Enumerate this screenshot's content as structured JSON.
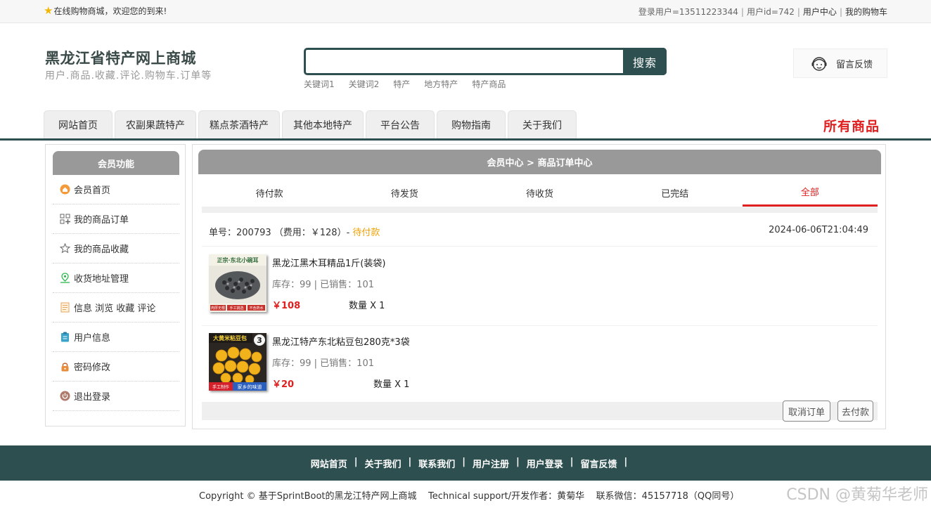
{
  "topbar": {
    "welcome": "在线购物商城，欢迎您的到来!",
    "login_user": "登录用户=13511223344",
    "user_id": "用户id=742",
    "user_center": "用户中心",
    "my_cart": "我的购物车"
  },
  "header": {
    "title": "黑龙江省特产网上商城",
    "subtitle": "用户.商品.收藏.评论.购物车.订单等",
    "search": {
      "value": "",
      "button": "搜索"
    },
    "hot_keywords": [
      "关键词1",
      "关键词2",
      "特产",
      "地方特产",
      "特产商品"
    ],
    "feedback": "留言反馈"
  },
  "nav": {
    "tabs": [
      "网站首页",
      "农副果蔬特产",
      "糕点茶酒特产",
      "其他本地特产",
      "平台公告",
      "购物指南",
      "关于我们"
    ],
    "all_goods": "所有商品"
  },
  "sidebar": {
    "title": "会员功能",
    "items": [
      {
        "label": "会员首页",
        "icon": "home-icon",
        "color": "#f29b38"
      },
      {
        "label": "我的商品订单",
        "icon": "grid-icon",
        "color": "#666666"
      },
      {
        "label": "我的商品收藏",
        "icon": "star-icon",
        "color": "#666666"
      },
      {
        "label": "收货地址管理",
        "icon": "location-icon",
        "color": "#2db84d"
      },
      {
        "label": "信息 浏览 收藏 评论",
        "icon": "document-icon",
        "color": "#e8a35c"
      },
      {
        "label": "用户信息",
        "icon": "clipboard-icon",
        "color": "#3aa3c9"
      },
      {
        "label": "密码修改",
        "icon": "lock-icon",
        "color": "#e88b3a"
      },
      {
        "label": "退出登录",
        "icon": "power-icon",
        "color": "#b07a6a"
      }
    ]
  },
  "main": {
    "breadcrumb": "会员中心 > 商品订单中心",
    "tabs": [
      "待付款",
      "待发货",
      "待收货",
      "已完结",
      "全部"
    ],
    "active_tab": "全部",
    "order": {
      "number_label": "单号：200793 （费用：￥128）-",
      "status": "待付款",
      "time": "2024-06-06T21:04:49",
      "items": [
        {
          "name": "黑龙江黑木耳精品1斤(装袋)",
          "stock": "库存：99 | 已销售：101",
          "price": "￥108",
          "qty": "数量 X 1",
          "thumb_top": "正宗·东北小碗耳",
          "thumb_bottom1": "肉厚无根",
          "thumb_bottom2": "手工挑选",
          "thumb_bottom3": "不含药水"
        },
        {
          "name": "黑龙江特产东北粘豆包280克*3袋",
          "stock": "库存：99 | 已销售：101",
          "price": "￥20",
          "qty": "数量 X 1",
          "thumb_top": "大黄米粘豆包",
          "thumb_badge": "3",
          "thumb_bottom1": "手工制作",
          "thumb_bottom2": "家乡的味道"
        }
      ],
      "cancel_button": "取消订单",
      "pay_button": "去付款"
    }
  },
  "footer": {
    "links": [
      "网站首页",
      "关于我们",
      "联系我们",
      "用户注册",
      "用户登录",
      "留言反馈"
    ],
    "copyright": "Copyright © 基于SprintBoot的黑龙江特产网上商城    Technical support/开发作者：黄菊华    联系微信：45157718（QQ同号）",
    "watermark": "CSDN @黄菊华老师"
  }
}
